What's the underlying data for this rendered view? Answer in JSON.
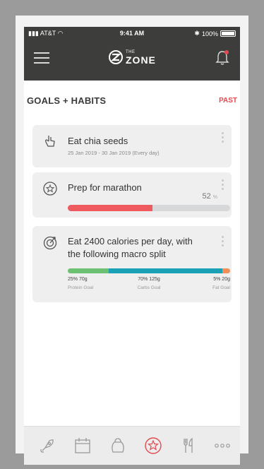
{
  "status": {
    "carrier": "AT&T",
    "time": "9:41 AM",
    "battery": "100%"
  },
  "header": {
    "logo_small": "THE",
    "logo_main": "ZONE"
  },
  "page": {
    "title": "GOALS + HABITS",
    "past_label": "PAST"
  },
  "goals": [
    {
      "icon": "hand-pointer-icon",
      "title": "Eat chia seeds",
      "subtitle": "25 Jan 2019 - 30 Jan 2019 (Every day)"
    },
    {
      "icon": "target-star-icon",
      "title": "Prep for marathon",
      "progress_percent": 52,
      "progress_value": "52",
      "progress_unit": "%"
    },
    {
      "icon": "target-icon",
      "title_line1": "Eat 2400 calories per day, with",
      "title_line2": "the following macro split",
      "macros": [
        {
          "value": "25% 70g",
          "label": "Protein Goal",
          "share": 25,
          "color": "#6cc072"
        },
        {
          "value": "70% 125g",
          "label": "Carbs Goal",
          "share": 70,
          "color": "#1aa1b5"
        },
        {
          "value": "5% 20g",
          "label": "Fat Goal",
          "share": 5,
          "color": "#f08f58"
        }
      ]
    }
  ],
  "tabs": [
    {
      "icon": "rocket-icon",
      "active": false
    },
    {
      "icon": "calendar-icon",
      "active": false
    },
    {
      "icon": "kettlebell-icon",
      "active": false
    },
    {
      "icon": "target-star-icon",
      "active": true
    },
    {
      "icon": "fork-knife-icon",
      "active": false
    },
    {
      "icon": "more-icon",
      "active": false
    }
  ],
  "colors": {
    "accent": "#e34a4f",
    "header_bg": "#3d3d3b",
    "progress": "#ee5a5d"
  }
}
